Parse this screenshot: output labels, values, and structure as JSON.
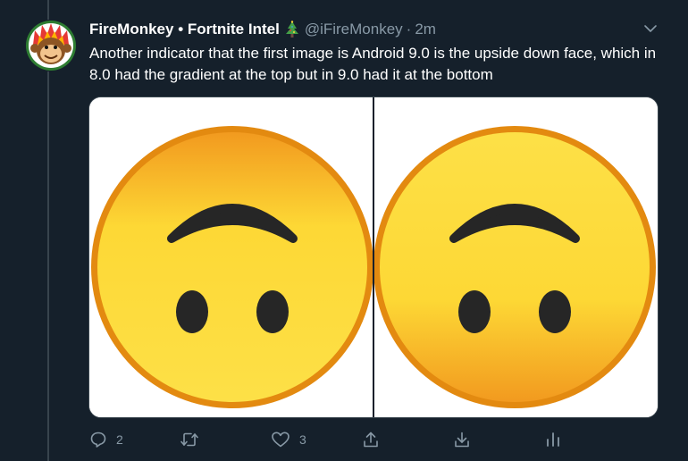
{
  "tweet": {
    "author_name": "FireMonkey • Fortnite Intel",
    "handle": "@iFireMonkey",
    "separator": "·",
    "time": "2m",
    "text": "Another indicator that the first image is Android 9.0 is the upside down face, which in 8.0 had the gradient at the top but in 9.0 had it at the bottom"
  },
  "icons": {
    "avatar": "fire-monkey-avatar",
    "badge": "christmas-tree-icon",
    "more": "chevron-down-icon",
    "reply": "reply-icon",
    "retweet": "retweet-icon",
    "like": "heart-icon",
    "share": "share-icon",
    "download": "download-icon",
    "analytics": "analytics-icon"
  },
  "actions": {
    "reply_count": "2",
    "retweet_count": "",
    "like_count": "3"
  },
  "colors": {
    "background": "#15202b",
    "border": "#38444d",
    "secondary_text": "#8899a6",
    "emoji_yellow": "#fdd835",
    "emoji_orange": "#f29a1f"
  }
}
